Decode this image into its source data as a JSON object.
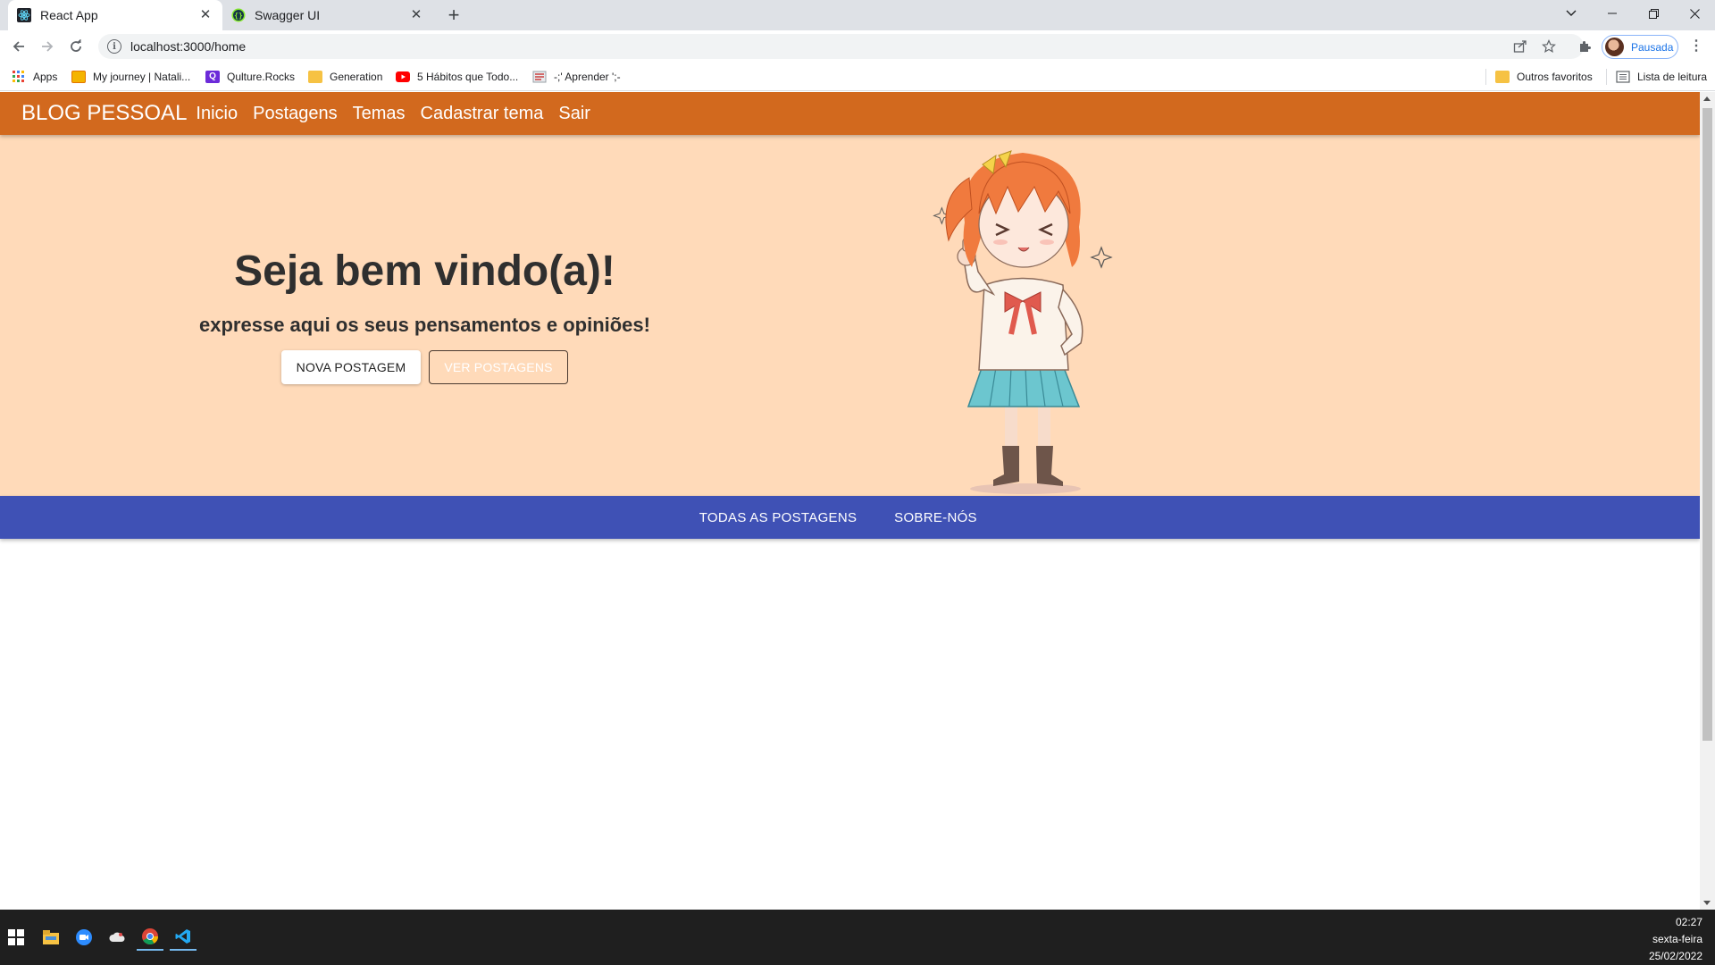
{
  "browser": {
    "tabs": [
      {
        "title": "React App",
        "active": true,
        "icon": "react-icon"
      },
      {
        "title": "Swagger UI",
        "active": false,
        "icon": "swagger-icon"
      }
    ],
    "url": "localhost:3000/home",
    "profile_label": "Pausada",
    "bookmarks": [
      {
        "label": "Apps",
        "icon": "apps-grid-icon"
      },
      {
        "label": "My journey | Natali...",
        "icon": "folder-icon"
      },
      {
        "label": "Qulture.Rocks",
        "icon": "qulture-icon"
      },
      {
        "label": "Generation",
        "icon": "folder-icon"
      },
      {
        "label": "5 Hábitos que Todo...",
        "icon": "youtube-icon"
      },
      {
        "label": "-;' Aprender ';-",
        "icon": "bookmark-page-icon"
      }
    ],
    "bookmarks_right": [
      {
        "label": "Outros favoritos",
        "icon": "folder-icon"
      },
      {
        "label": "Lista de leitura",
        "icon": "reading-list-icon"
      }
    ]
  },
  "appbar": {
    "brand": "BLOG PESSOAL",
    "links": [
      "Inicio",
      "Postagens",
      "Temas",
      "Cadastrar tema",
      "Sair"
    ]
  },
  "hero": {
    "title": "Seja bem vindo(a)!",
    "subtitle": "expresse aqui os seus pensamentos e opiniões!",
    "primary_button": "NOVA POSTAGEM",
    "secondary_button": "VER POSTAGENS"
  },
  "tabs": [
    "TODAS AS POSTAGENS",
    "SOBRE-NÓS"
  ],
  "taskbar": {
    "time": "02:27",
    "day": "sexta-feira",
    "date": "25/02/2022"
  },
  "colors": {
    "appbar": "#d2691e",
    "hero_bg": "#ffdab9",
    "tabs_bg": "#3f51b5"
  }
}
